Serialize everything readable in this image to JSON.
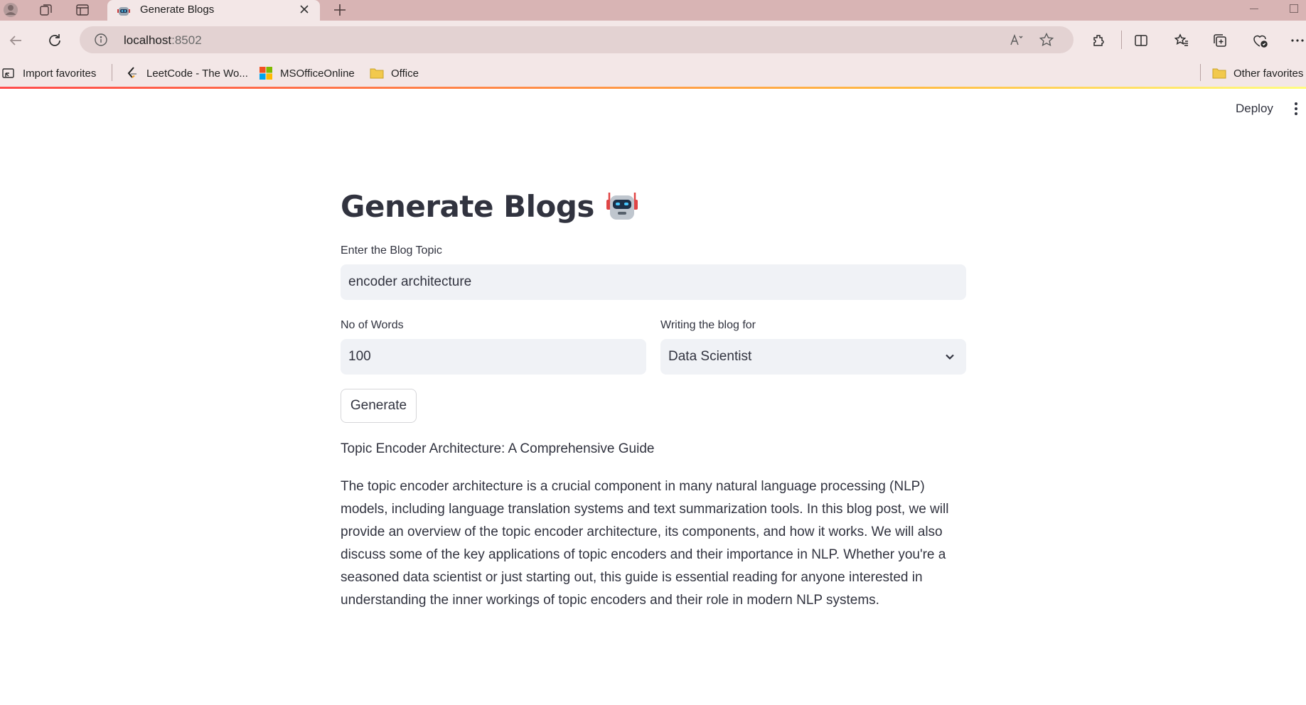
{
  "browser": {
    "tab_title": "Generate Blogs",
    "url_host": "localhost",
    "url_port": ":8502",
    "favorites": [
      {
        "label": "Import favorites",
        "icon": "import-icon"
      },
      {
        "label": "LeetCode - The Wo...",
        "icon": "leetcode-icon"
      },
      {
        "label": "MSOfficeOnline",
        "icon": "microsoft-icon"
      },
      {
        "label": "Office",
        "icon": "folder-icon"
      }
    ],
    "other_favorites": "Other favorites"
  },
  "app": {
    "deploy_label": "Deploy",
    "title": "Generate Blogs",
    "topic_label": "Enter the Blog Topic",
    "topic_value": "encoder architecture",
    "words_label": "No of Words",
    "words_value": "100",
    "audience_label": "Writing the blog for",
    "audience_value": "Data Scientist",
    "generate_label": "Generate",
    "result_title": "Topic Encoder Architecture: A Comprehensive Guide",
    "result_body": "The topic encoder architecture is a crucial component in many natural language processing (NLP) models, including language translation systems and text summarization tools. In this blog post, we will provide an overview of the topic encoder architecture, its components, and how it works. We will also discuss some of the key applications of topic encoders and their importance in NLP. Whether you're a seasoned data scientist or just starting out, this guide is essential reading for anyone interested in understanding the inner workings of topic encoders and their role in modern NLP systems."
  },
  "colors": {
    "tabbar": "#d8b4b4",
    "toolbar": "#f3e7e7",
    "text": "#31333f",
    "input_bg": "#f0f2f6"
  }
}
